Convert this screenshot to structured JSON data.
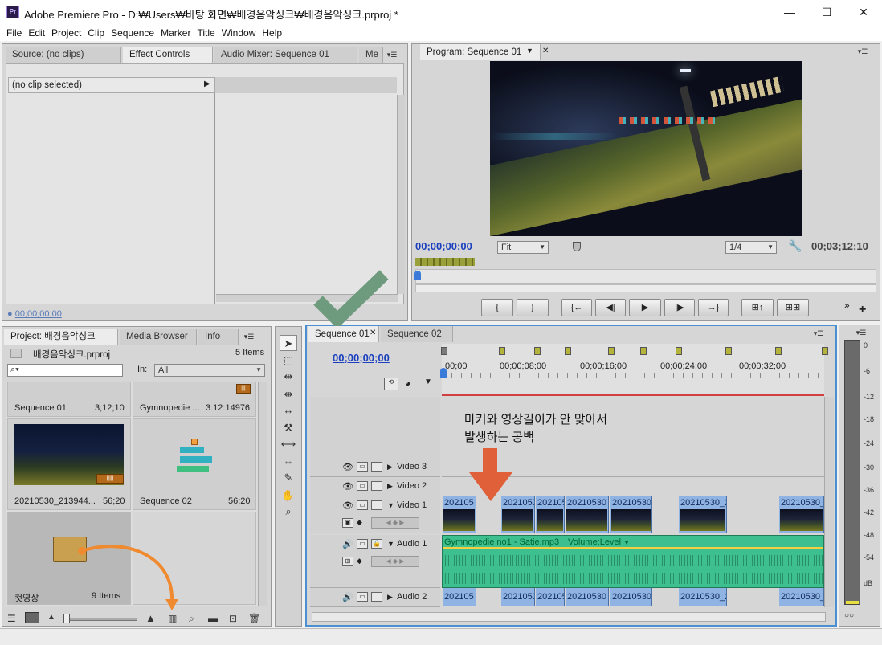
{
  "window": {
    "app_icon": "Pr",
    "title": "Adobe Premiere Pro - D:₩Users₩바탕 화면₩배경음악싱크₩배경음악싱크.prproj *",
    "minimize": "—",
    "maximize": "☐",
    "close": "✕"
  },
  "menu": [
    "File",
    "Edit",
    "Project",
    "Clip",
    "Sequence",
    "Marker",
    "Title",
    "Window",
    "Help"
  ],
  "source_panel": {
    "tabs": [
      "Source: (no clips)",
      "Effect Controls",
      "Audio Mixer: Sequence 01",
      "Me"
    ],
    "active_tab": "Effect Controls",
    "clip_label": "(no clip selected)",
    "timecode": "00;00;00;00"
  },
  "program_panel": {
    "tab": "Program: Sequence 01",
    "current_time": "00;00;00;00",
    "duration": "00;03;12;10",
    "fit": "Fit",
    "resolution": "1/4",
    "transport": [
      "{",
      "}",
      "{←",
      "◀|",
      "▶",
      "|▶",
      "→}",
      "⊞↑",
      "⊞⊞"
    ]
  },
  "project_panel": {
    "tabs": [
      "Project: 배경음악싱크",
      "Media Browser",
      "Info"
    ],
    "file": "배경음악싱크.prproj",
    "item_count": "5 Items",
    "search_placeholder": "",
    "in_label": "In:",
    "in_value": "All",
    "items": [
      {
        "name": "Sequence 01",
        "duration": "3;12;10"
      },
      {
        "name": "Gymnopedie ...",
        "duration": "3:12:14976"
      },
      {
        "name": "20210530_213944...",
        "duration": "56;20"
      },
      {
        "name": "Sequence 02",
        "duration": "56;20"
      },
      {
        "name": "컷영상",
        "duration": "9 Items"
      }
    ]
  },
  "timeline": {
    "tabs": [
      "Sequence 01",
      "Sequence 02"
    ],
    "current_time": "00;00;00;00",
    "ruler": [
      "00;00",
      "00;00;08;00",
      "00;00;16;00",
      "00;00;24;00",
      "00;00;32;00"
    ],
    "tracks": {
      "v3": "Video 3",
      "v2": "Video 2",
      "v1": "Video 1",
      "a1": "Audio 1",
      "a2": "Audio 2"
    },
    "annotation_line1": "마커와 영상길이가 안 맞아서",
    "annotation_line2": "발생하는 공백",
    "audio_clip_label": "Gymnopedie no1 - Satie.mp3",
    "volume_label": "Volume:Level",
    "video_clips": [
      "202105",
      "20210530",
      "2021053",
      "20210530",
      "20210530_",
      "20210530_2",
      "20210530_2"
    ],
    "audio2_clips": [
      "202105",
      "20210530",
      "2021053",
      "20210530",
      "20210530_",
      "20210530_2",
      "20210530_2"
    ]
  },
  "vu_meter": {
    "labels": [
      "0",
      "-6",
      "-12",
      "-18",
      "-24",
      "-30",
      "-36",
      "-42",
      "-48",
      "-54",
      "dB"
    ]
  },
  "colors": {
    "accent_blue": "#1a3fbf",
    "audio_green": "#3dbf8f",
    "clip_blue": "#8fb3e3",
    "arrow_red": "#e0603a",
    "check_green": "#6e9a7e",
    "curve_orange": "#f08a30"
  }
}
